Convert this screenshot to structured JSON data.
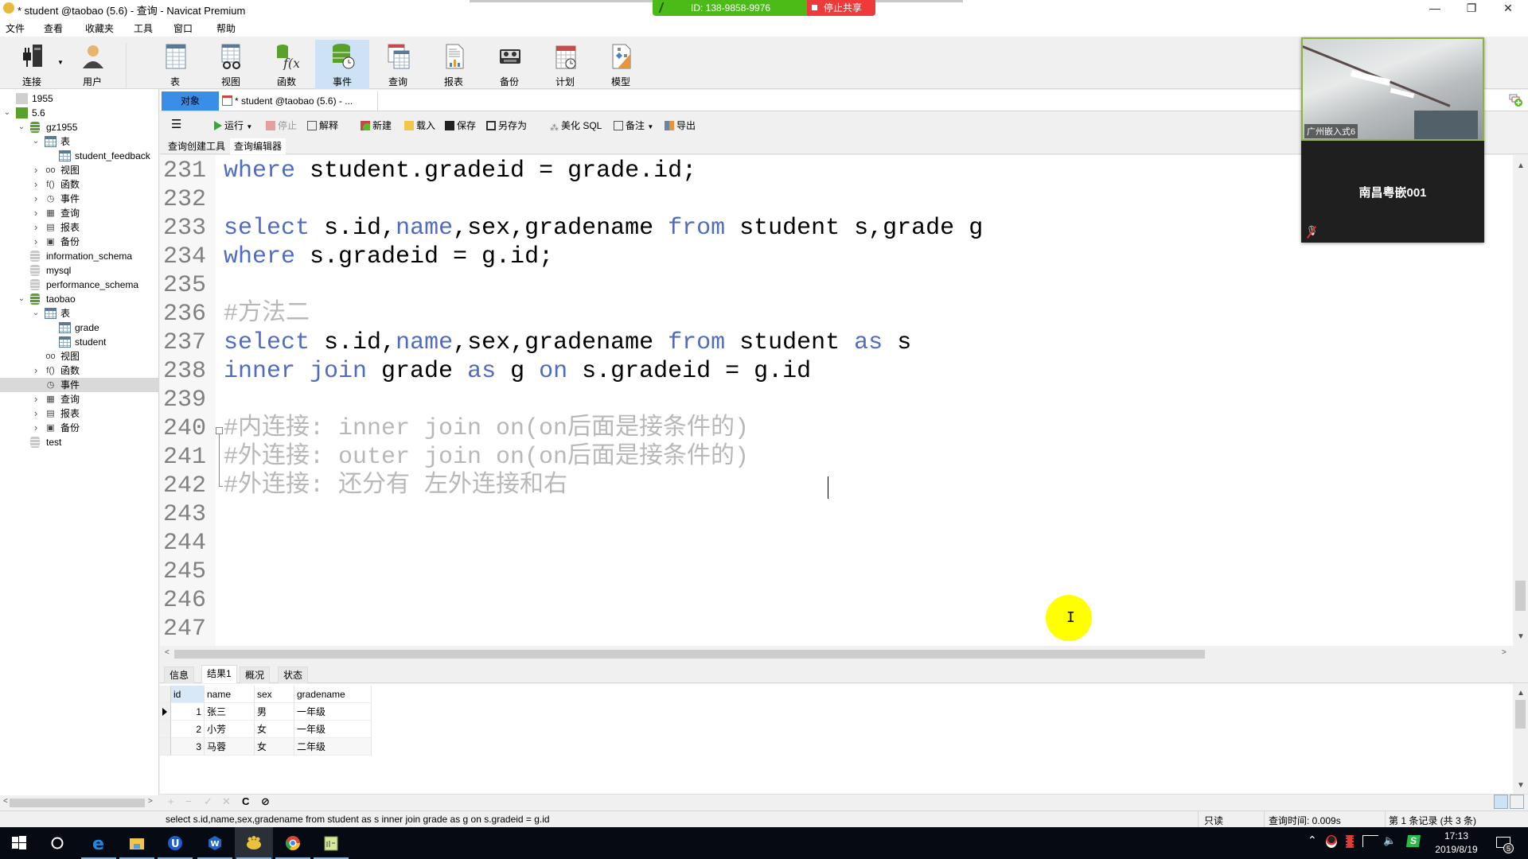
{
  "window": {
    "title": "* student @taobao (5.6) - 查询 - Navicat Premium",
    "controls": {
      "minimize": "—",
      "restore": "❐",
      "close": "✕"
    }
  },
  "share_banner": {
    "id_text": "ID: 138-9858-9976",
    "stop_label": "停止共享",
    "id_color": "#4cbb17",
    "stop_color": "#ee3a3a"
  },
  "menu": [
    "文件",
    "查看",
    "收藏夹",
    "工具",
    "窗口",
    "帮助"
  ],
  "toolbar": {
    "connect": "连接",
    "user": "用户",
    "items": [
      {
        "label": "表",
        "icon": "table-icon"
      },
      {
        "label": "视图",
        "icon": "view-icon"
      },
      {
        "label": "函数",
        "icon": "function-icon"
      },
      {
        "label": "事件",
        "icon": "event-icon",
        "active": true
      },
      {
        "label": "查询",
        "icon": "query-icon"
      },
      {
        "label": "报表",
        "icon": "report-icon"
      },
      {
        "label": "备份",
        "icon": "backup-icon"
      },
      {
        "label": "计划",
        "icon": "schedule-icon"
      },
      {
        "label": "模型",
        "icon": "model-icon"
      }
    ]
  },
  "sidebar": {
    "tree": [
      {
        "label": "1955",
        "level": 0,
        "icon": "connection-gray",
        "expander": ""
      },
      {
        "label": "5.6",
        "level": 0,
        "icon": "connection-green",
        "expander": "v"
      },
      {
        "label": "gz1955",
        "level": 1,
        "icon": "database-green",
        "expander": "v"
      },
      {
        "label": "表",
        "level": 2,
        "icon": "table",
        "expander": "v"
      },
      {
        "label": "student_feedback",
        "level": 3,
        "icon": "table",
        "expander": ""
      },
      {
        "label": "视图",
        "level": 2,
        "icon": "view",
        "expander": ">"
      },
      {
        "label": "函数",
        "level": 2,
        "icon": "function",
        "expander": ">"
      },
      {
        "label": "事件",
        "level": 2,
        "icon": "event",
        "expander": ">"
      },
      {
        "label": "查询",
        "level": 2,
        "icon": "query",
        "expander": ">"
      },
      {
        "label": "报表",
        "level": 2,
        "icon": "report",
        "expander": ">"
      },
      {
        "label": "备份",
        "level": 2,
        "icon": "backup",
        "expander": ">"
      },
      {
        "label": "information_schema",
        "level": 1,
        "icon": "database-gray",
        "expander": ""
      },
      {
        "label": "mysql",
        "level": 1,
        "icon": "database-gray",
        "expander": ""
      },
      {
        "label": "performance_schema",
        "level": 1,
        "icon": "database-gray",
        "expander": ""
      },
      {
        "label": "taobao",
        "level": 1,
        "icon": "database-green",
        "expander": "v"
      },
      {
        "label": "表",
        "level": 2,
        "icon": "table",
        "expander": "v"
      },
      {
        "label": "grade",
        "level": 3,
        "icon": "table",
        "expander": ""
      },
      {
        "label": "student",
        "level": 3,
        "icon": "table",
        "expander": ""
      },
      {
        "label": "视图",
        "level": 2,
        "icon": "view",
        "expander": ""
      },
      {
        "label": "函数",
        "level": 2,
        "icon": "function",
        "expander": ">"
      },
      {
        "label": "事件",
        "level": 2,
        "icon": "event",
        "expander": "",
        "selected": true
      },
      {
        "label": "查询",
        "level": 2,
        "icon": "query",
        "expander": ">"
      },
      {
        "label": "报表",
        "level": 2,
        "icon": "report",
        "expander": ">"
      },
      {
        "label": "备份",
        "level": 2,
        "icon": "backup",
        "expander": ">"
      },
      {
        "label": "test",
        "level": 1,
        "icon": "database-gray",
        "expander": ""
      }
    ]
  },
  "tabs": {
    "objects": "对象",
    "query_tab": "* student @taobao (5.6) - ..."
  },
  "editor_toolbar": {
    "run": "运行",
    "stop": "停止",
    "explain": "解释",
    "new": "新建",
    "load": "载入",
    "save": "保存",
    "save_as": "另存为",
    "beautify": "美化 SQL",
    "comment": "备注",
    "export": "导出"
  },
  "subtabs": {
    "builder": "查询创建工具",
    "editor": "查询编辑器"
  },
  "editor": {
    "lines": [
      {
        "n": "231",
        "tokens": [
          [
            "kw",
            "where"
          ],
          [
            "t",
            " student.gradeid = grade.id;"
          ]
        ]
      },
      {
        "n": "232",
        "tokens": []
      },
      {
        "n": "233",
        "tokens": [
          [
            "kw",
            "select"
          ],
          [
            "t",
            " s.id,"
          ],
          [
            "kw",
            "name"
          ],
          [
            "t",
            ",sex,gradename "
          ],
          [
            "kw",
            "from"
          ],
          [
            "t",
            " student s,grade g"
          ]
        ]
      },
      {
        "n": "234",
        "tokens": [
          [
            "kw",
            "where"
          ],
          [
            "t",
            " s.gradeid = g.id;"
          ]
        ]
      },
      {
        "n": "235",
        "tokens": []
      },
      {
        "n": "236",
        "tokens": [
          [
            "cm",
            "#方法二"
          ]
        ]
      },
      {
        "n": "237",
        "tokens": [
          [
            "kw",
            "select"
          ],
          [
            "t",
            " s.id,"
          ],
          [
            "kw",
            "name"
          ],
          [
            "t",
            ",sex,gradename "
          ],
          [
            "kw",
            "from"
          ],
          [
            "t",
            " student "
          ],
          [
            "kw",
            "as"
          ],
          [
            "t",
            " s"
          ]
        ]
      },
      {
        "n": "238",
        "tokens": [
          [
            "kw",
            "inner"
          ],
          [
            "t",
            " "
          ],
          [
            "kw",
            "join"
          ],
          [
            "t",
            " grade "
          ],
          [
            "kw",
            "as"
          ],
          [
            "t",
            " g "
          ],
          [
            "kw",
            "on"
          ],
          [
            "t",
            " s.gradeid = g.id"
          ]
        ]
      },
      {
        "n": "239",
        "tokens": []
      },
      {
        "n": "240",
        "tokens": [
          [
            "cm",
            "#内连接: inner join on(on后面是接条件的)"
          ]
        ]
      },
      {
        "n": "241",
        "tokens": [
          [
            "cm",
            "#外连接: outer join on(on后面是接条件的)"
          ]
        ]
      },
      {
        "n": "242",
        "tokens": [
          [
            "cm",
            "#外连接: 还分有 左外连接和右"
          ]
        ]
      },
      {
        "n": "243",
        "tokens": []
      },
      {
        "n": "244",
        "tokens": []
      },
      {
        "n": "245",
        "tokens": []
      },
      {
        "n": "246",
        "tokens": []
      },
      {
        "n": "247",
        "tokens": []
      }
    ],
    "keyword_color": "#4f6cc4",
    "comment_color": "#b8b8b8"
  },
  "result_tabs": [
    "信息",
    "结果1",
    "概况",
    "状态"
  ],
  "result": {
    "columns": [
      "id",
      "name",
      "sex",
      "gradename"
    ],
    "rows": [
      [
        "1",
        "张三",
        "男",
        "一年级"
      ],
      [
        "2",
        "小芳",
        "女",
        "一年级"
      ],
      [
        "3",
        "马蓉",
        "女",
        "二年级"
      ]
    ]
  },
  "grid_nav": {
    "add": "+",
    "delete": "−",
    "apply": "✓",
    "discard": "✕",
    "refresh": "C",
    "stop": "⊘"
  },
  "statusbar": {
    "sql": "select s.id,name,sex,gradename from student as s  inner join grade as g on s.gradeid = g.id",
    "readonly": "只读",
    "query_time": "查询时间: 0.009s",
    "record": "第 1 条记录 (共 3 条)"
  },
  "video_overlay": {
    "camera_label": "广州嵌入式6",
    "participant": "南昌粤嵌001"
  },
  "taskbar": {
    "time": "17:13",
    "date": "2019/8/19",
    "notifications": "5",
    "apps": [
      "start",
      "search",
      "edge",
      "file-explorer",
      "u-app",
      "wps",
      "navicat",
      "browser",
      "notepad"
    ]
  }
}
